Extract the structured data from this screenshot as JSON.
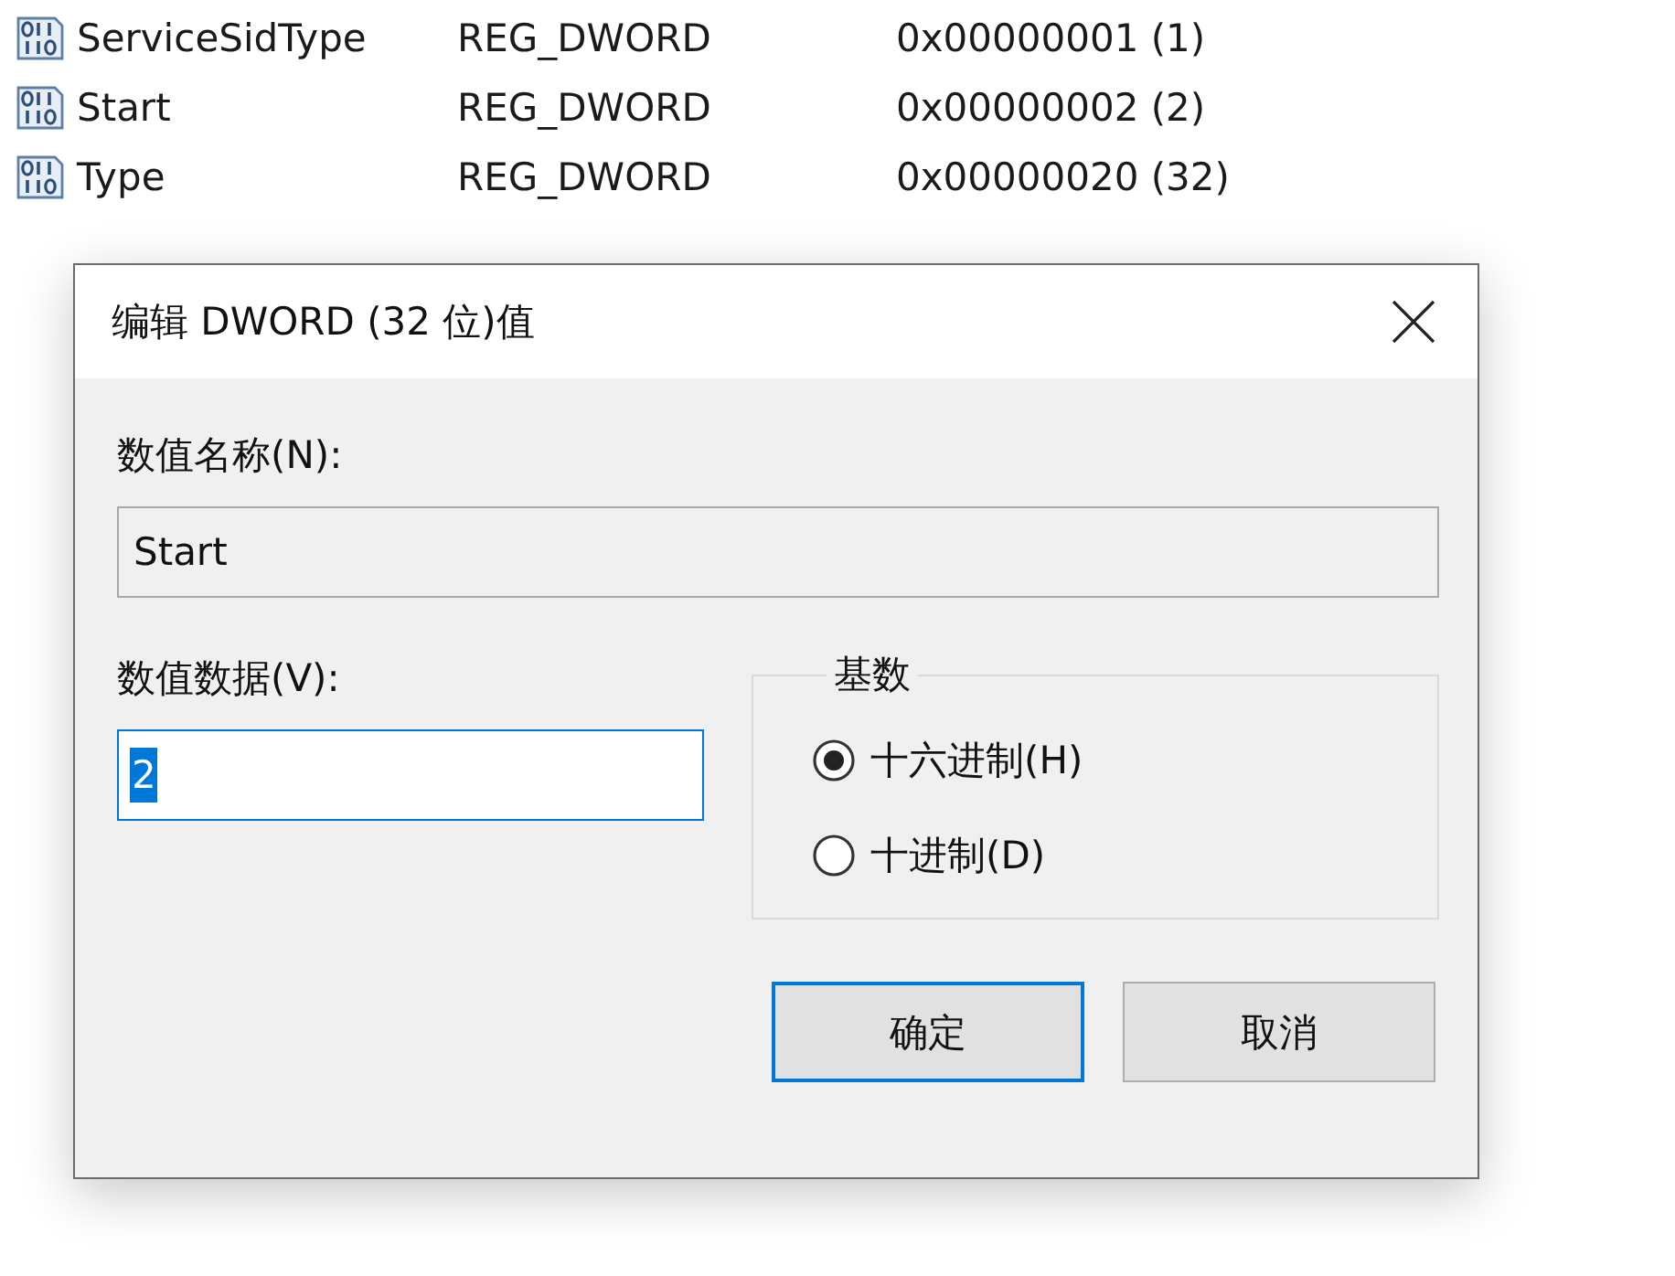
{
  "registry_values": [
    {
      "name": "ServiceSidType",
      "type": "REG_DWORD",
      "data": "0x00000001 (1)"
    },
    {
      "name": "Start",
      "type": "REG_DWORD",
      "data": "0x00000002 (2)"
    },
    {
      "name": "Type",
      "type": "REG_DWORD",
      "data": "0x00000020 (32)"
    }
  ],
  "dialog": {
    "title": "编辑 DWORD (32 位)值",
    "value_name": {
      "label": "数值名称(N):",
      "value": "Start"
    },
    "value_data": {
      "label": "数值数据(V):",
      "value": "2",
      "text_selected": true
    },
    "base": {
      "label": "基数",
      "options": [
        {
          "label": "十六进制(H)",
          "selected": true
        },
        {
          "label": "十进制(D)",
          "selected": false
        }
      ]
    },
    "buttons": [
      {
        "label": "确定",
        "kind": "default"
      },
      {
        "label": "取消",
        "kind": "normal"
      }
    ]
  }
}
